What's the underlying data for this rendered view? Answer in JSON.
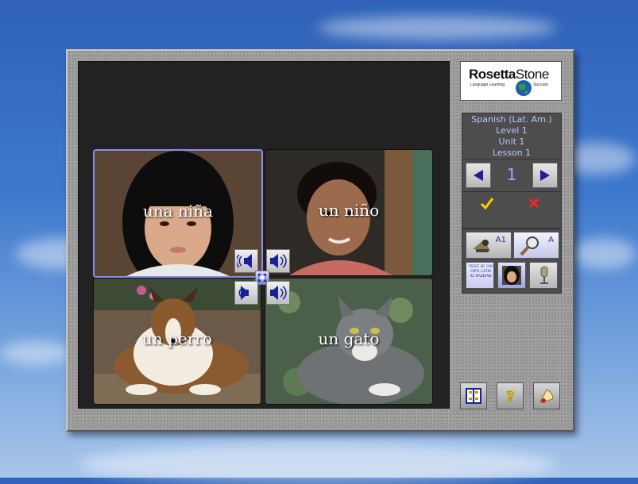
{
  "logo": {
    "brand_part1": "Rosetta",
    "brand_part2": "Stone",
    "tagline_left": "Language Learning",
    "tagline_right": "Success"
  },
  "course": {
    "language": "Spanish (Lat. Am.)",
    "level": "Level 1",
    "unit": "Unit 1",
    "lesson": "Lesson 1"
  },
  "navigation": {
    "page": "1"
  },
  "pictures": [
    {
      "caption": "una niña",
      "subject": "girl"
    },
    {
      "caption": "un niño",
      "subject": "boy"
    },
    {
      "caption": "un perro",
      "subject": "dog"
    },
    {
      "caption": "un gato",
      "subject": "cat"
    }
  ],
  "tools": {
    "listen_level": "A1",
    "magnify_level": "A",
    "text_button_label": "TEST IE ON OPO LITH AI XAIHAK"
  },
  "colors": {
    "selection": "#8a8cf0",
    "panel": "#4d4d4d",
    "accent_text": "#bcc4ff",
    "check": "#ffcc00",
    "cross": "#ff2020"
  }
}
